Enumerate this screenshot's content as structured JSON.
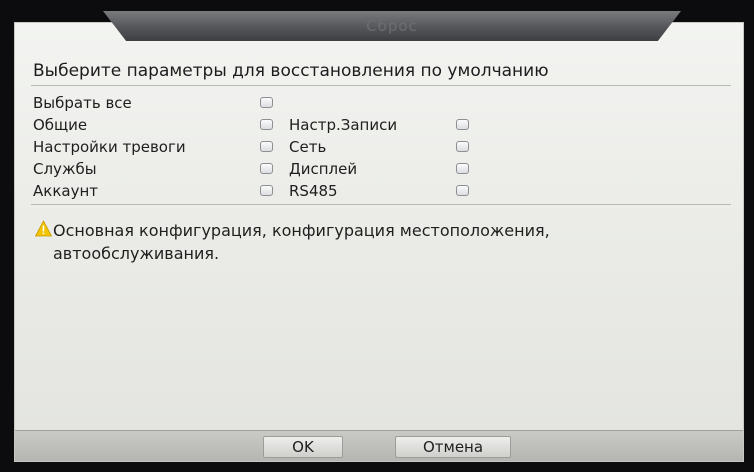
{
  "window": {
    "title": "Сброс"
  },
  "heading": "Выберите параметры для восстановления по умолчанию",
  "options": {
    "select_all": "Выбрать все",
    "general": "Общие",
    "alarm_settings": "Настройки тревоги",
    "services": "Службы",
    "account": "Аккаунт",
    "record_settings": "Настр.Записи",
    "network": "Сеть",
    "display": "Дисплей",
    "rs485": "RS485"
  },
  "checkbox_states": {
    "select_all": false,
    "general": false,
    "alarm_settings": false,
    "services": false,
    "account": false,
    "record_settings": false,
    "network": false,
    "display": false,
    "rs485": false
  },
  "warning": {
    "icon": "warning-icon",
    "text": "Основная конфигурация, конфигурация местоположения, автообслуживания."
  },
  "buttons": {
    "ok": "OK",
    "cancel": "Отмена"
  },
  "colors": {
    "warning_icon": "#f2c400",
    "title_bar": "#55565a",
    "dialog_bg": "#ecede9"
  }
}
